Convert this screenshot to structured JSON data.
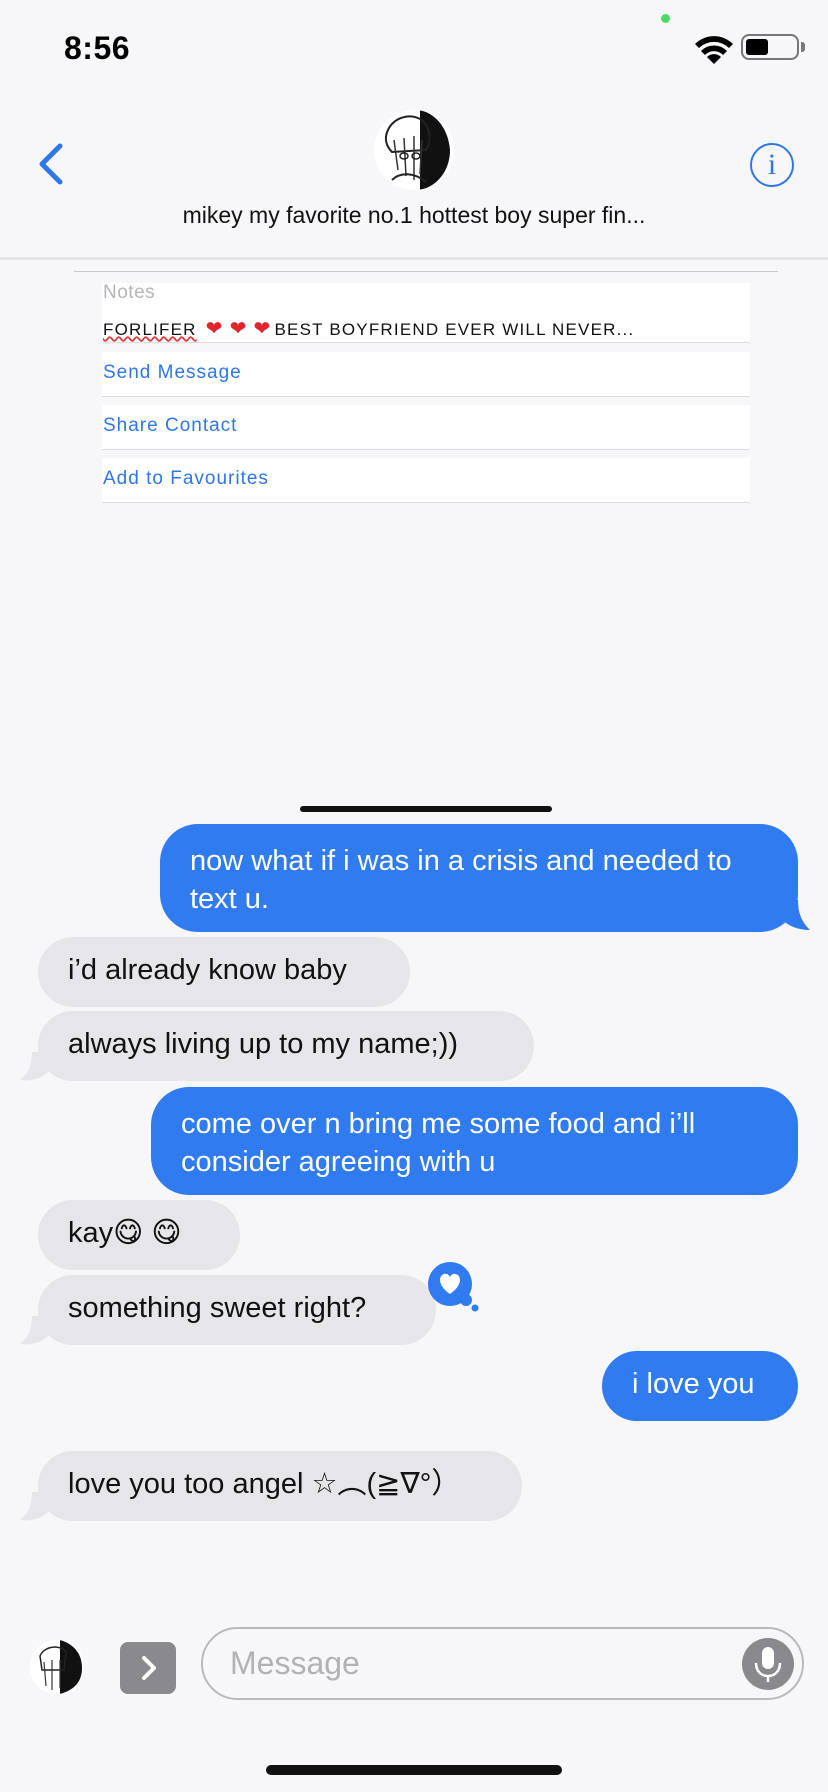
{
  "status_bar": {
    "time": "8:56",
    "battery_level": 0.45
  },
  "header": {
    "contact_name": "mikey my favorite no.1 hottest boy super fin...",
    "info_glyph": "i"
  },
  "contact_card": {
    "notes_label": "Notes",
    "notes_prefix": "FORLIFER",
    "notes_hearts": [
      "❤",
      "❤",
      "❤"
    ],
    "notes_suffix": "BEST BOYFRIEND EVER WILL NEVER...",
    "actions": [
      "Send Message",
      "Share Contact",
      "Add to Favourites"
    ]
  },
  "messages": [
    {
      "direction": "outgoing",
      "text": "now what if i was in a crisis and needed to text u."
    },
    {
      "direction": "incoming",
      "text": "i’d already know baby"
    },
    {
      "direction": "incoming",
      "text": "always living up to my name;))"
    },
    {
      "direction": "outgoing",
      "text": "come over n bring me some food and i’ll consider agreeing with u"
    },
    {
      "direction": "incoming",
      "text": "kay😋 😋"
    },
    {
      "direction": "incoming",
      "text": "something sweet right?",
      "tapback": "heart"
    },
    {
      "direction": "outgoing",
      "text": "i love you"
    },
    {
      "direction": "incoming",
      "text": "love you too angel ☆︵(≧∇°）"
    }
  ],
  "composer": {
    "placeholder": "Message"
  },
  "colors": {
    "accent": "#2f76e8",
    "outgoing_bubble": "#2f7bef",
    "incoming_bubble": "#e5e5ea",
    "heart": "#e0242e"
  },
  "icons": [
    "back-chevron-icon",
    "info-icon",
    "wifi-icon",
    "battery-icon",
    "heart-tapback-icon",
    "chevron-right-icon",
    "microphone-icon"
  ]
}
